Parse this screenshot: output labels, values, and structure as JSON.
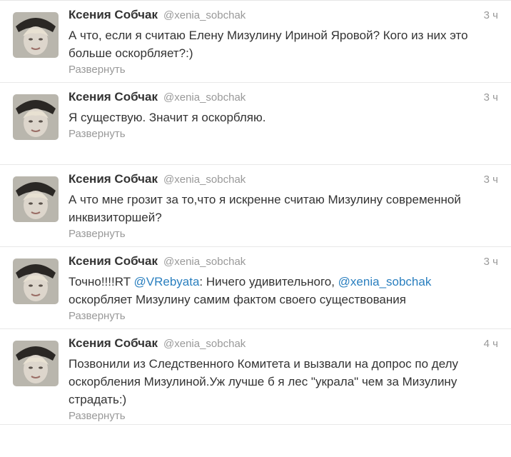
{
  "timeline": {
    "tweets": [
      {
        "name": "Ксения Собчак",
        "handle": "@xenia_sobchak",
        "time": "3 ч",
        "text": "А что, если я считаю Елену Мизулину Ириной Яровой? Кого из них это больше оскорбляет?:)",
        "expand": "Развернуть"
      },
      {
        "name": "Ксения Собчак",
        "handle": "@xenia_sobchak",
        "time": "3 ч",
        "text": "Я существую. Значит я оскорбляю.",
        "expand": "Развернуть"
      },
      {
        "name": "Ксения Собчак",
        "handle": "@xenia_sobchak",
        "time": "3 ч",
        "text": "А что мне грозит за то,что я искренне считаю Мизулину современной инквизиторшей?",
        "expand": "Развернуть"
      },
      {
        "name": "Ксения Собчак",
        "handle": "@xenia_sobchak",
        "time": "3 ч",
        "text_before": "Точно!!!!RT ",
        "mention1": "@VRebyata",
        "text_middle": ": Ничего удивительного, ",
        "mention2": "@xenia_sobchak",
        "text_after": " оскорбляет Мизулину самим фактом своего существования",
        "expand": "Развернуть"
      },
      {
        "name": "Ксения Собчак",
        "handle": "@xenia_sobchak",
        "time": "4 ч",
        "text": "Позвонили из Следственного Комитета и вызвали на допрос по делу оскорбления Мизулиной.Уж лучше б я лес \"украла\" чем за Мизулину страдать:)",
        "expand": "Развернуть"
      }
    ]
  },
  "colors": {
    "link": "#2a7fbf",
    "meta": "#999999",
    "text": "#333333"
  }
}
